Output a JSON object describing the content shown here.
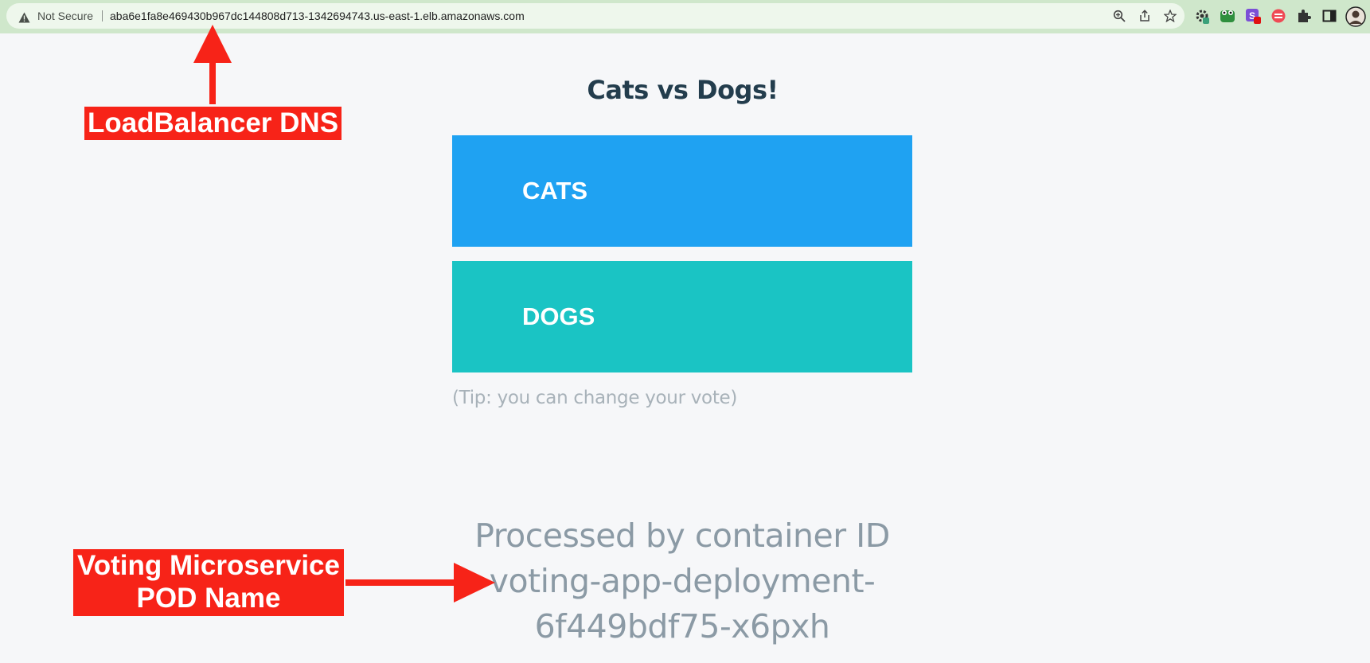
{
  "browser": {
    "security_label": "Not Secure",
    "url": "aba6e1fa8e469430b967dc144808d713-1342694743.us-east-1.elb.amazonaws.com",
    "omnibox_icons": [
      "zoom-icon",
      "share-icon",
      "bookmark-star-icon"
    ],
    "extension_icons": [
      "gear-extension-icon",
      "frog-extension-icon",
      "s-extension-icon",
      "red-circle-extension-icon",
      "puzzle-extensions-icon",
      "side-panel-icon",
      "profile-avatar"
    ]
  },
  "page": {
    "title": "Cats vs Dogs!",
    "option_a": "CATS",
    "option_b": "DOGS",
    "tip": "(Tip: you can change your vote)",
    "container_label": "Processed by container ID voting-app-deployment-6f449bdf75-x6pxh"
  },
  "annotations": {
    "dns_label": "LoadBalancer DNS",
    "pod_label_line1": "Voting Microservice",
    "pod_label_line2": "POD Name"
  },
  "colors": {
    "cats": "#1fa2f2",
    "dogs": "#1ac4c4",
    "annotation": "#f72318",
    "title": "#233d4d",
    "browser_bar": "#cfe7cb"
  }
}
